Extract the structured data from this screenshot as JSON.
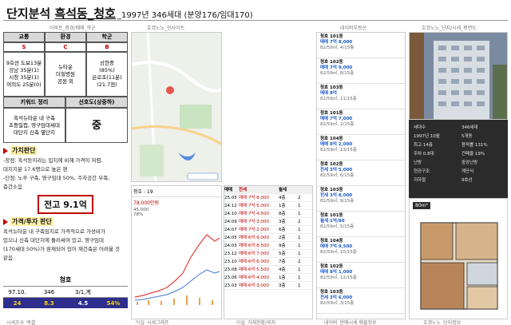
{
  "title": {
    "main_prefix": "단지분석 ",
    "main_underlined": "흑석동_청호",
    "sub": "_1997년 346세대 (분양176/임대170)"
  },
  "top_captions": [
    "아파트_환경/매매_학군",
    "호갱노노_인사이트",
    "네이버부동산",
    "호갱노노_단지/시세_평면도"
  ],
  "score_table": {
    "headers": [
      "교통",
      "환경",
      "학군"
    ],
    "grades": [
      "S",
      "C",
      "B"
    ],
    "descriptions": [
      [
        "9호선 도보13분",
        "강남 35분(1)",
        "시청 35분(1)",
        "여의도 25분(0)"
      ],
      [
        "뉴타운",
        "더힐병원",
        "공원 외"
      ],
      [
        "상현중",
        "(85%)",
        "은로초(11분)",
        "(21.7점)"
      ]
    ]
  },
  "keyword": {
    "header_left": "키워드 정리",
    "header_right": "선호도(상중하)",
    "lines": [
      "흑석뉴타운 내 구축",
      "초등밀접, 영구임대세대",
      "대단지 신축 옆단지"
    ],
    "preference": "중"
  },
  "value_section": {
    "label": "가치판단",
    "lines": [
      "-장점: 흑석동이라는 입지에 비해 가격이 저렴,",
      "대지지분 17.6평으로 높은 편",
      "-단점: 노후 구축, 영구임대 50%, 주차공간 부족,",
      "층간소음"
    ],
    "price": "전고 9.1억"
  },
  "invest_section": {
    "label": "가격/투자 판단",
    "lines": [
      "흑석뉴타운 내 구축임지로 가격적으로 가성비가",
      "있으나 신축 대단지에 둘러싸여 있고, 영구임대",
      "(170세대 50%)가 혼재되어 있어 재건축은 어려울 것",
      "같음."
    ]
  },
  "summary": {
    "name": "청호",
    "row1": [
      "97.10.",
      "346",
      "3/1,계",
      ""
    ],
    "row2": [
      "24",
      "8.3",
      "4.5",
      "54%"
    ]
  },
  "bottom_captions": [
    "시세조사_엑셀",
    "아실_시세그래프",
    "아실_거래현황/외지",
    "네이버_현매시세 매물정보",
    "호갱노노_단지정보"
  ],
  "chart_header": "청호 : 19",
  "chart_values": [
    "78,000만원",
    "45,000",
    "78%"
  ],
  "trade_header": [
    "매매",
    "전세",
    "월세"
  ],
  "trade_rows": [
    [
      "25.05",
      "매매 7억 8,000",
      "4층",
      "2"
    ],
    [
      "24.12",
      "매매 7억 5,000",
      "1층",
      "1"
    ],
    [
      "24.10",
      "매매 7억 4,500",
      "8층",
      "1"
    ],
    [
      "24.09",
      "매매 7억 3,000",
      "3층",
      "2"
    ],
    [
      "24.07",
      "매매 7억 2,000",
      "6층",
      "1"
    ],
    [
      "24.05",
      "매매 6억 9,000",
      "2층",
      "1"
    ],
    [
      "24.03",
      "매매 6억 8,500",
      "9층",
      "1"
    ],
    [
      "23.12",
      "매매 6억 7,000",
      "5층",
      "1"
    ],
    [
      "23.10",
      "매매 6억 6,000",
      "7층",
      "2"
    ],
    [
      "23.08",
      "매매 6억 5,500",
      "4층",
      "1"
    ],
    [
      "23.06",
      "매매 6억 4,000",
      "1층",
      "1"
    ],
    [
      "23.03",
      "매매 6억 3,000",
      "3층",
      "1"
    ]
  ],
  "listings": [
    {
      "title": "청호 101동",
      "price": "매매 7억 8,000",
      "sub": "82/59㎡, 4/15층"
    },
    {
      "title": "청호 102동",
      "price": "매매 7억 9,000",
      "sub": "82/59㎡, 8/15층"
    },
    {
      "title": "청호 103동",
      "price": "매매 8억",
      "sub": "82/59㎡, 11/15층"
    },
    {
      "title": "청호 101동",
      "price": "매매 7억 7,000",
      "sub": "82/59㎡, 2/15층"
    },
    {
      "title": "청호 104동",
      "price": "매매 8억 2,000",
      "sub": "82/59㎡, 13/15층"
    },
    {
      "title": "청호 102동",
      "price": "전세 3억 5,000",
      "sub": "82/59㎡, 6/15층"
    },
    {
      "title": "청호 103동",
      "price": "전세 3억 8,000",
      "sub": "82/59㎡, 9/15층"
    },
    {
      "title": "청호 101동",
      "price": "월세 1억/80",
      "sub": "82/59㎡, 5/15층"
    },
    {
      "title": "청호 104동",
      "price": "매매 7억 9,500",
      "sub": "82/59㎡, 10/15층"
    },
    {
      "title": "청호 102동",
      "price": "매매 8억 1,000",
      "sub": "82/59㎡, 12/15층"
    },
    {
      "title": "청호 103동",
      "price": "전세 3억 6,000",
      "sub": "82/59㎡, 3/15층"
    }
  ],
  "info_rows": [
    [
      "세대수",
      "346세대"
    ],
    [
      "1997년 10월",
      "5개동"
    ],
    [
      "최고 14층",
      "용적률 131%"
    ],
    [
      "주차 0.8대",
      "건폐율 19%"
    ],
    [
      "난방",
      "중앙난방"
    ],
    [
      "현관구조",
      "계단식"
    ],
    [
      "지하철",
      "9호선"
    ]
  ],
  "floorplan_tag": "80m²",
  "colors": {
    "accent_red": "#c00000",
    "summary_blue": "#2e2e8c",
    "grade_red": "#c00000"
  }
}
